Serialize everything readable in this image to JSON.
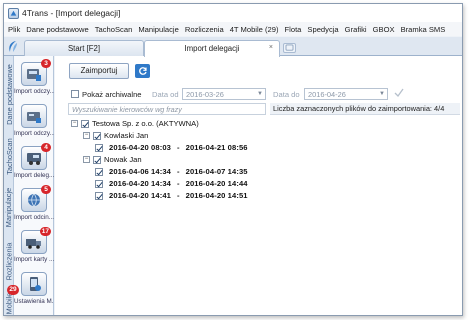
{
  "window": {
    "title": "4Trans - [Import delegacji]"
  },
  "menu": [
    "Plik",
    "Dane podstawowe",
    "TachoScan",
    "Manipulacje",
    "Rozliczenia",
    "4T Mobile (29)",
    "Flota",
    "Spedycja",
    "Grafiki",
    "GBOX",
    "Bramka SMS"
  ],
  "tabs": [
    {
      "label": "Start [F2]"
    },
    {
      "label": "Import delegacji",
      "active": true,
      "close": "×"
    }
  ],
  "vertical_tabs": [
    "Dane podstawowe",
    "TachoScan",
    "Manipulacje",
    "Rozliczenia",
    "Mobile"
  ],
  "mobile_badge": "29",
  "tools": [
    {
      "label": "Import odczy...",
      "badge": "3",
      "icon": "tachograph-import-icon"
    },
    {
      "label": "Import odczy...",
      "badge": "",
      "icon": "card-import-icon"
    },
    {
      "label": "Import deleg...",
      "badge": "4",
      "icon": "delegation-import-icon"
    },
    {
      "label": "Import odcin...",
      "badge": "5",
      "icon": "globe-import-icon"
    },
    {
      "label": "Import karty ...",
      "badge": "17",
      "icon": "truck-card-icon"
    },
    {
      "label": "Ustawienia M...",
      "badge": "",
      "icon": "mobile-settings-icon"
    }
  ],
  "toolbar": {
    "import_label": "Zaimportuj"
  },
  "filter": {
    "archive_label": "Pokaż archiwalne",
    "date_from_label": "Data od",
    "date_from": "2016-03-26",
    "date_to_label": "Data do",
    "date_to": "2016-04-26"
  },
  "search": {
    "placeholder": "Wyszukiwanie kierowców wg frazy"
  },
  "count_text": "Liczba zaznaczonych plików do zaimportowania: 4/4",
  "tree": {
    "company": "Testowa Sp. z o.o. (AKTYWNA)",
    "drivers": [
      {
        "name": "Kowlaski Jan",
        "trips": [
          {
            "from": "2016-04-20 08:03",
            "to": "2016-04-21 08:56"
          }
        ]
      },
      {
        "name": "Nowak Jan",
        "trips": [
          {
            "from": "2016-04-06 14:34",
            "to": "2016-04-07 14:35"
          },
          {
            "from": "2016-04-20 14:34",
            "to": "2016-04-20 14:44"
          },
          {
            "from": "2016-04-20 14:41",
            "to": "2016-04-20 14:51"
          }
        ]
      }
    ],
    "separator": "-"
  },
  "colors": {
    "accent": "#2f79c8",
    "badge": "#d7262b",
    "sidebar": "#dbe5f1"
  }
}
